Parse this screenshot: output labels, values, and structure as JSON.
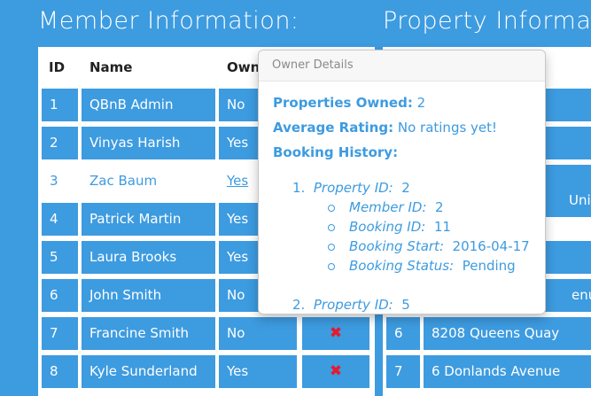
{
  "member_heading": "Member Information:",
  "property_heading": "Property Informat",
  "member_table": {
    "headers": {
      "id": "ID",
      "name": "Name",
      "owner": "Own"
    },
    "rows": [
      {
        "id": "1",
        "name": "QBnB Admin",
        "owner": "No"
      },
      {
        "id": "2",
        "name": "Vinyas Harish",
        "owner": "Yes"
      },
      {
        "id": "3",
        "name": "Zac Baum",
        "owner": "Yes"
      },
      {
        "id": "4",
        "name": "Patrick Martin",
        "owner": "Yes"
      },
      {
        "id": "5",
        "name": "Laura Brooks",
        "owner": "Yes"
      },
      {
        "id": "6",
        "name": "John Smith",
        "owner": "No"
      },
      {
        "id": "7",
        "name": "Francine Smith",
        "owner": "No"
      },
      {
        "id": "8",
        "name": "Kyle Sunderland",
        "owner": "Yes"
      }
    ],
    "delete_glyph": "✖"
  },
  "property_table": {
    "visible_fragments": {
      "unit": "Unit",
      "enue": "enue",
      "row6_id": "6",
      "row6_address": "8208 Queens Quay",
      "row7_id": "7",
      "row7_address": "6 Donlands Avenue"
    }
  },
  "popover": {
    "title": "Owner Details",
    "properties_owned_label": "Properties Owned:",
    "properties_owned_value": "2",
    "average_rating_label": "Average Rating:",
    "average_rating_value": "No ratings yet!",
    "booking_history_label": "Booking History:",
    "entries": [
      {
        "number": "1.",
        "property_id_label": "Property ID:",
        "property_id": "2",
        "member_id_label": "Member ID:",
        "member_id": "2",
        "booking_id_label": "Booking ID:",
        "booking_id": "11",
        "booking_start_label": "Booking Start:",
        "booking_start": "2016-04-17",
        "booking_status_label": "Booking Status:",
        "booking_status": "Pending"
      },
      {
        "number": "2.",
        "property_id_label": "Property ID:",
        "property_id": "5"
      }
    ]
  },
  "colors": {
    "accent": "#3d9be0",
    "delete": "#e8192c"
  }
}
